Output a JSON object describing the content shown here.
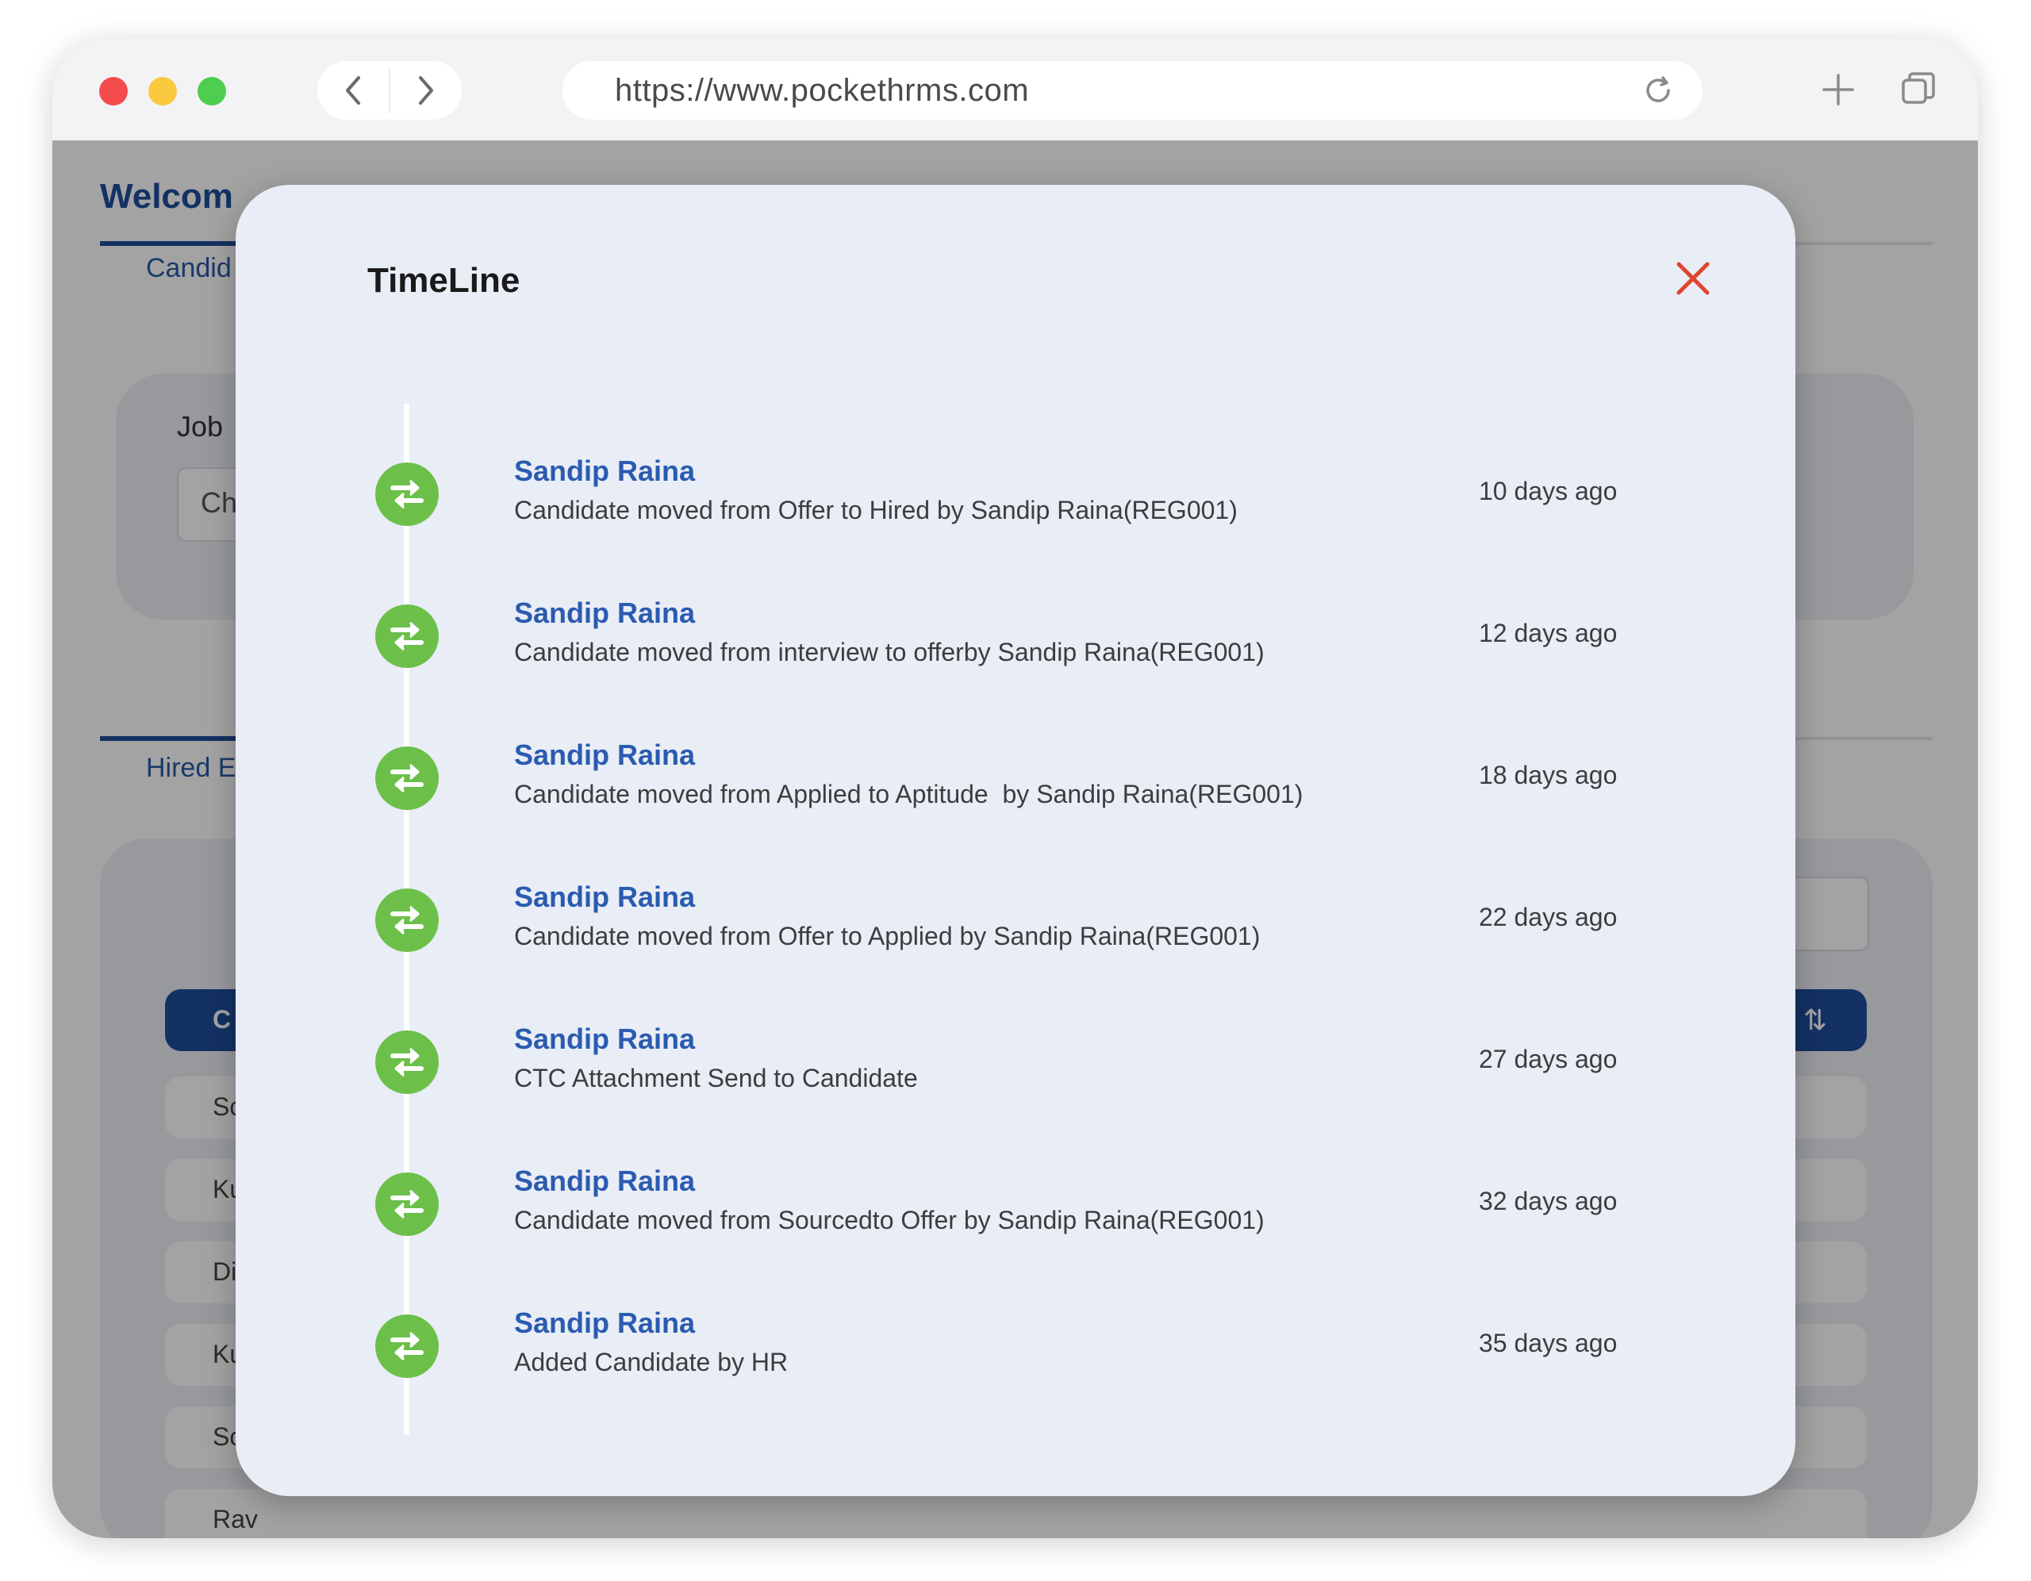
{
  "browser": {
    "url": "https://www.pockethrms.com"
  },
  "background_app": {
    "welcome": "Welcom",
    "tab_candidates": "Candid",
    "job_label": "Job",
    "job_select_value": "Ch",
    "tab_hired": "Hired E",
    "table_header": "C",
    "rows": [
      "Sc",
      "Ku",
      "Di",
      "Ku",
      "Sc",
      "Rav"
    ]
  },
  "modal": {
    "title": "TimeLine",
    "entries": [
      {
        "name": "Sandip Raina",
        "description": "Candidate moved from Offer to Hired by Sandip Raina(REG001)",
        "time": "10 days ago"
      },
      {
        "name": "Sandip Raina",
        "description": "Candidate moved from interview to offerby Sandip Raina(REG001)",
        "time": "12 days ago"
      },
      {
        "name": "Sandip Raina",
        "description": "Candidate moved from Applied to Aptitude  by Sandip Raina(REG001)",
        "time": "18 days ago"
      },
      {
        "name": "Sandip Raina",
        "description": "Candidate moved from Offer to Applied by Sandip Raina(REG001)",
        "time": "22 days ago"
      },
      {
        "name": "Sandip Raina",
        "description": "CTC Attachment Send to Candidate",
        "time": "27 days ago"
      },
      {
        "name": "Sandip Raina",
        "description": "Candidate moved from Sourcedto Offer by Sandip Raina(REG001)",
        "time": "32 days ago"
      },
      {
        "name": "Sandip Raina",
        "description": "Added Candidate by HR",
        "time": "35 days ago"
      }
    ]
  },
  "icons": {
    "entry_icon": "transfer-arrows-icon",
    "close": "close-icon"
  },
  "colors": {
    "accent": "#1e4e9c",
    "entry_icon_bg": "#6cc04a",
    "close": "#e0452e",
    "modal_bg": "#e9edf6"
  }
}
